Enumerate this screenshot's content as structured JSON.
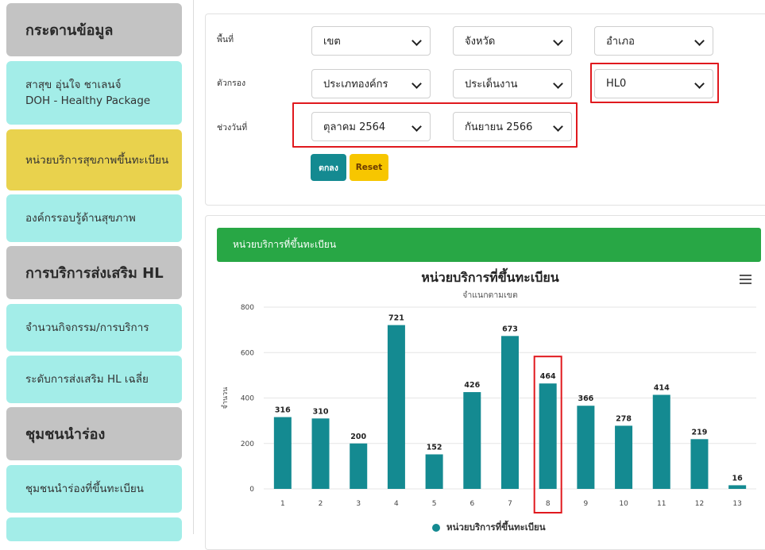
{
  "sidebar": {
    "items": [
      {
        "type": "header",
        "label": "กระดานข้อมูล"
      },
      {
        "type": "link",
        "label": "สาสุข อุ่นใจ ชาเลนจ์",
        "label2": "DOH - Healthy Package"
      },
      {
        "type": "active",
        "label": "หน่วยบริการสุขภาพขึ้นทะเบียน"
      },
      {
        "type": "link",
        "label": "องค์กรรอบรู้ด้านสุขภาพ"
      },
      {
        "type": "header",
        "label": "การบริการส่งเสริม HL"
      },
      {
        "type": "link",
        "label": "จำนวนกิจกรรม/การบริการ"
      },
      {
        "type": "link",
        "label": "ระดับการส่งเสริม HL เฉลี่ย"
      },
      {
        "type": "header",
        "label": "ชุมชนนำร่อง"
      },
      {
        "type": "link",
        "label": "ชุมชนนำร่องที่ขึ้นทะเบียน"
      }
    ]
  },
  "filters": {
    "area_label": "พื้นที่",
    "filter_label": "ตัวกรอง",
    "date_label": "ช่วงวันที่",
    "region": "เขต",
    "province": "จังหวัด",
    "district": "อำเภอ",
    "org_type": "ประเภทองค์กร",
    "work_issue": "ประเด็นงาน",
    "hl_level": "HL0",
    "date_from": "ตุลาคม 2564",
    "date_to": "กันยายน 2566",
    "ok_button": "ตกลง",
    "reset_button": "Reset"
  },
  "card": {
    "header": "หน่วยบริการที่ขึ้นทะเบียน"
  },
  "colors": {
    "bar": "#148a91",
    "header_green": "#28a745",
    "highlight": "#e0191e"
  },
  "chart_data": {
    "type": "bar",
    "title": "หน่วยบริการที่ขึ้นทะเบียน",
    "subtitle": "จำแนกตามเขต",
    "ylabel": "จำนวน",
    "categories": [
      "1",
      "2",
      "3",
      "4",
      "5",
      "6",
      "7",
      "8",
      "9",
      "10",
      "11",
      "12",
      "13"
    ],
    "series": [
      {
        "name": "หน่วยบริการที่ขึ้นทะเบียน",
        "values": [
          316,
          310,
          200,
          721,
          152,
          426,
          673,
          464,
          366,
          278,
          414,
          219,
          16
        ]
      }
    ],
    "ylim": [
      0,
      800
    ],
    "yticks": [
      0,
      200,
      400,
      600,
      800
    ],
    "legend": "bottom",
    "grid": true,
    "highlighted_category": "8"
  }
}
